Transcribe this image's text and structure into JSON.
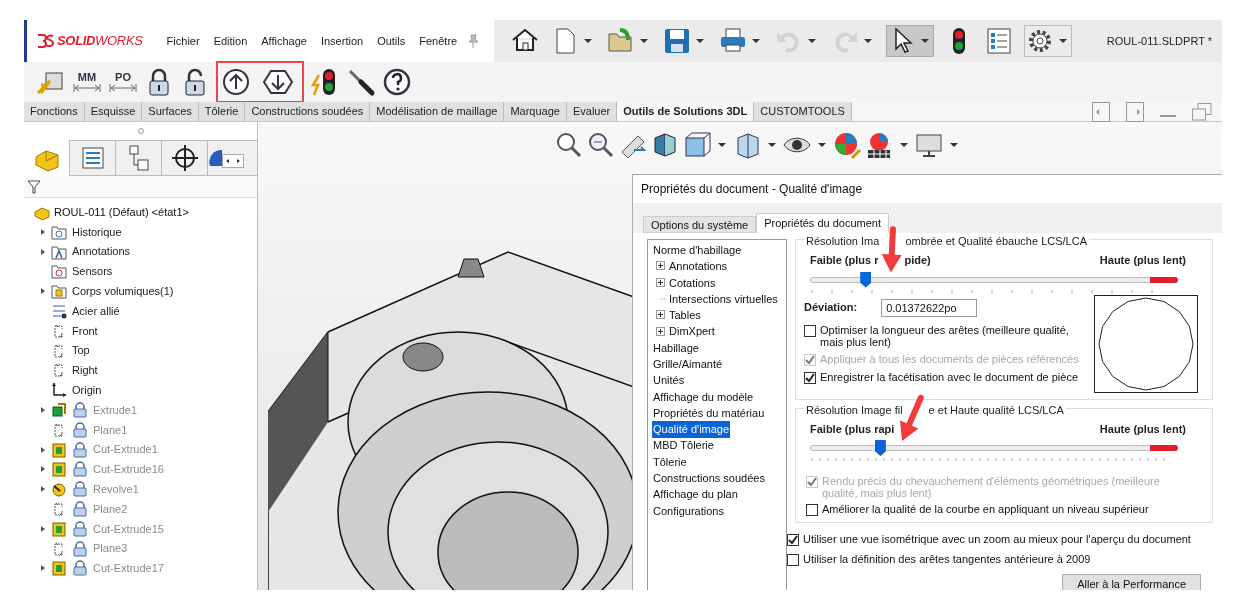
{
  "menu_bar": {
    "logo": "**SOLID**WORKS",
    "menus": [
      "Fichier",
      "Edition",
      "Affichage",
      "Insertion",
      "Outils",
      "Fenêtre"
    ],
    "document_title": "ROUL-011.SLDPRT *"
  },
  "quick_toolbar": [
    {
      "kind": "home",
      "disabled": false,
      "pressed": false
    },
    {
      "kind": "new",
      "disabled": false,
      "pressed": false
    },
    {
      "kind": "open",
      "disabled": false,
      "pressed": false
    },
    {
      "kind": "save",
      "disabled": false,
      "pressed": false
    },
    {
      "kind": "print",
      "disabled": false,
      "pressed": false
    },
    {
      "kind": "undo",
      "disabled": true,
      "pressed": false
    },
    {
      "kind": "redo",
      "disabled": true,
      "pressed": false
    },
    {
      "kind": "select",
      "disabled": false,
      "pressed": true
    },
    {
      "kind": "traffic",
      "disabled": false,
      "pressed": false
    },
    {
      "kind": "list",
      "disabled": false,
      "pressed": false
    },
    {
      "kind": "gear",
      "disabled": false,
      "pressed": false
    }
  ],
  "addin_toolbar": [
    {
      "highlighted": false,
      "items": [
        {
          "kind": "rebuild"
        },
        {
          "kind": "units",
          "label": "MM"
        },
        {
          "kind": "units",
          "label": "PO"
        },
        {
          "kind": "lock"
        },
        {
          "kind": "unlock"
        }
      ]
    },
    {
      "highlighted": true,
      "items": [
        {
          "kind": "up"
        },
        {
          "kind": "down"
        }
      ]
    },
    {
      "highlighted": false,
      "items": [
        {
          "kind": "traffic"
        },
        {
          "kind": "screwdriver"
        },
        {
          "kind": "help"
        }
      ]
    }
  ],
  "command_tabs": [
    {
      "label": "Fonctions",
      "selected": false
    },
    {
      "label": "Esquisse",
      "selected": false
    },
    {
      "label": "Surfaces",
      "selected": false
    },
    {
      "label": "Tôlerie",
      "selected": false
    },
    {
      "label": "Constructions soudées",
      "selected": false
    },
    {
      "label": "Modélisation de maillage",
      "selected": false
    },
    {
      "label": "Marquage",
      "selected": false
    },
    {
      "label": "Evaluer",
      "selected": false
    },
    {
      "label": "Outils de Solutions 3DL",
      "selected": true
    },
    {
      "label": "CUSTOMTOOLS",
      "selected": false
    }
  ],
  "feature_tree": {
    "root": "ROUL-011 (Défaut) <état1>",
    "items": [
      {
        "label": "Historique",
        "kind": "history",
        "collapsible": true,
        "locked": false,
        "dimmed": false
      },
      {
        "label": "Annotations",
        "kind": "annotations",
        "collapsible": true,
        "locked": false,
        "dimmed": false
      },
      {
        "label": "Sensors",
        "kind": "sensors",
        "collapsible": false,
        "locked": false,
        "dimmed": false
      },
      {
        "label": "Corps volumiques(1)",
        "kind": "bodies",
        "collapsible": true,
        "locked": false,
        "dimmed": false
      },
      {
        "label": "Acier allié",
        "kind": "material",
        "collapsible": false,
        "locked": false,
        "dimmed": false
      },
      {
        "label": "Front",
        "kind": "plane",
        "collapsible": false,
        "locked": false,
        "dimmed": false
      },
      {
        "label": "Top",
        "kind": "plane",
        "collapsible": false,
        "locked": false,
        "dimmed": false
      },
      {
        "label": "Right",
        "kind": "plane",
        "collapsible": false,
        "locked": false,
        "dimmed": false
      },
      {
        "label": "Origin",
        "kind": "origin",
        "collapsible": false,
        "locked": false,
        "dimmed": false
      },
      {
        "label": "Extrude1",
        "kind": "extrude",
        "collapsible": true,
        "locked": true,
        "dimmed": true
      },
      {
        "label": "Plane1",
        "kind": "plane",
        "collapsible": false,
        "locked": true,
        "dimmed": true
      },
      {
        "label": "Cut-Extrude1",
        "kind": "cut",
        "collapsible": true,
        "locked": true,
        "dimmed": true
      },
      {
        "label": "Cut-Extrude16",
        "kind": "cut",
        "collapsible": true,
        "locked": true,
        "dimmed": true
      },
      {
        "label": "Revolve1",
        "kind": "revolve",
        "collapsible": true,
        "locked": true,
        "dimmed": true
      },
      {
        "label": "Plane2",
        "kind": "plane",
        "collapsible": false,
        "locked": true,
        "dimmed": true
      },
      {
        "label": "Cut-Extrude15",
        "kind": "cut",
        "collapsible": true,
        "locked": true,
        "dimmed": true
      },
      {
        "label": "Plane3",
        "kind": "plane",
        "collapsible": false,
        "locked": true,
        "dimmed": true
      },
      {
        "label": "Cut-Extrude17",
        "kind": "cut",
        "collapsible": true,
        "locked": true,
        "dimmed": true
      }
    ]
  },
  "dialog": {
    "title": "Propriétés du document - Qualité d'image",
    "tabs": [
      {
        "label": "Options du système",
        "selected": false
      },
      {
        "label": "Propriétés du document",
        "selected": true
      }
    ],
    "nav": [
      {
        "label": "Norme d'habillage",
        "selected": false,
        "children": [
          {
            "label": "Annotations",
            "selected": false,
            "collapsible": true
          },
          {
            "label": "Cotations",
            "selected": false,
            "collapsible": true
          },
          {
            "label": "Intersections virtuelles",
            "selected": false,
            "collapsible": false
          },
          {
            "label": "Tables",
            "selected": false,
            "collapsible": true
          },
          {
            "label": "DimXpert",
            "selected": false,
            "collapsible": true
          }
        ]
      },
      {
        "label": "Habillage",
        "selected": false
      },
      {
        "label": "Grille/Aimanté",
        "selected": false
      },
      {
        "label": "Unités",
        "selected": false
      },
      {
        "label": "Affichage du modèle",
        "selected": false
      },
      {
        "label": "Propriétés du matériau",
        "selected": false
      },
      {
        "label": "Qualité d'image",
        "selected": true
      },
      {
        "label": "MBD Tôlerie",
        "selected": false
      },
      {
        "label": "Tôlerie",
        "selected": false
      },
      {
        "label": "Constructions soudées",
        "selected": false
      },
      {
        "label": "Affichage du plan",
        "selected": false
      },
      {
        "label": "Configurations",
        "selected": false
      }
    ],
    "groups": [
      {
        "title_parts": [
          "Résolution Ima",
          "ombrée et Qualité ébauche LCS/LCA"
        ],
        "low_label_parts": [
          "Faible (plus r",
          "pide)"
        ],
        "high_label": "Haute (plus lent)",
        "level": 0.15,
        "deviation_label": "Déviation:",
        "deviation_value": "0.01372622po",
        "options": [
          {
            "label": "Optimiser la longueur des arêtes (meilleure qualité, mais plus lent)",
            "checked": false,
            "disabled": false
          },
          {
            "label": "Appliquer à tous les documents de pièces référencés",
            "checked": true,
            "disabled": true
          },
          {
            "label": "Enregistrer la facétisation avec le document de pièce",
            "checked": true,
            "disabled": false
          }
        ]
      },
      {
        "title_parts": [
          "Résolution Image fil",
          "e et Haute qualité LCS/LCA"
        ],
        "low_label_parts": [
          "Faible (plus rapi"
        ],
        "high_label": "Haute (plus lent)",
        "level": 0.19,
        "options": [
          {
            "label": "Rendu précis du chevauchement d'éléments géométriques (meilleure qualité, mais plus lent)",
            "checked": true,
            "disabled": true
          },
          {
            "label": "Améliorer la qualité de la courbe en appliquant un niveau supérieur",
            "checked": false,
            "disabled": false
          }
        ]
      }
    ],
    "options": [
      {
        "label": "Utiliser une vue isométrique avec un zoom au mieux pour l'aperçu du document",
        "checked": true,
        "disabled": false
      },
      {
        "label": "Utiliser la définition des arêtes tangentes antérieure à 2009",
        "checked": false,
        "disabled": false
      }
    ],
    "button": "Aller à la Performance"
  }
}
